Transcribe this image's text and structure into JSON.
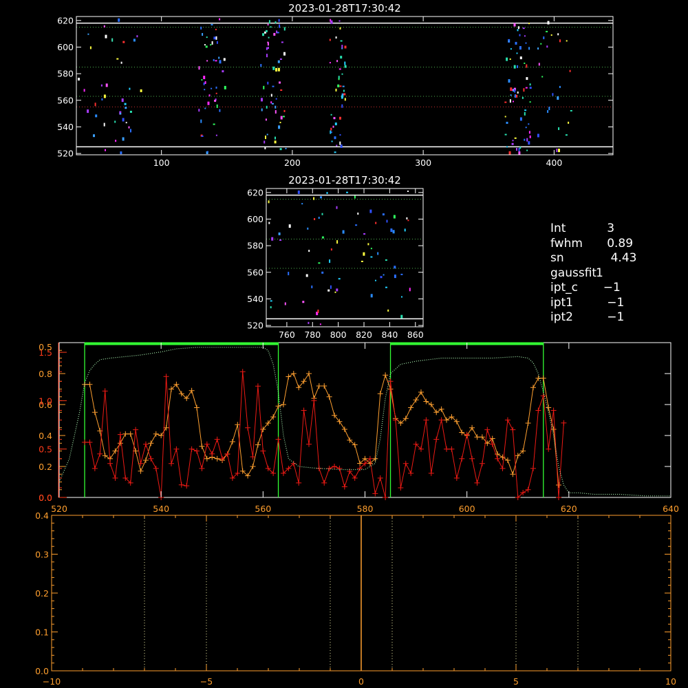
{
  "info_panel": {
    "rows": [
      {
        "key": "Int",
        "value": "   3"
      },
      {
        "key": "fwhm",
        "value": "   0.89"
      },
      {
        "key": "sn",
        "value": "    4.43"
      },
      {
        "key": "gaussfit",
        "value": "1"
      },
      {
        "key": "ipt_c",
        "value": "  −1"
      },
      {
        "key": "ipt1",
        "value": "   −1"
      },
      {
        "key": "ipt2",
        "value": "   −1"
      }
    ]
  },
  "colors": {
    "background": "#000000",
    "axes": "#ffffff",
    "axes_orange": "#ff9f2e",
    "axes_red": "#ff3a1a",
    "series_orange": "#ffa030",
    "series_red": "#ee1a14",
    "model_dotted": "#a8f0b0",
    "window_green": "#33ff33",
    "guide_green": "#4fb34f",
    "guide_red": "#d03030",
    "guide_yellow": "#e8e6a0"
  },
  "chart_data": [
    {
      "id": "top_image",
      "type": "heatmap",
      "title": "2023-01-28T17:30:42",
      "xlim": [
        35,
        445
      ],
      "ylim": [
        519,
        623
      ],
      "xticks": [
        100,
        200,
        300,
        400
      ],
      "yticks": [
        520,
        540,
        560,
        580,
        600,
        620
      ],
      "hlines_white": [
        618,
        525
      ],
      "hlines_green_dotted": [
        615,
        585,
        563
      ],
      "hlines_red_dotted": [
        555
      ],
      "pixel_columns": [
        {
          "x_center": 60,
          "spread": 25,
          "count": 40
        },
        {
          "x_center": 138,
          "spread": 10,
          "count": 45
        },
        {
          "x_center": 185,
          "spread": 10,
          "count": 55
        },
        {
          "x_center": 234,
          "spread": 6,
          "count": 45
        },
        {
          "x_center": 372,
          "spread": 10,
          "count": 65
        },
        {
          "x_center": 400,
          "spread": 15,
          "count": 25
        }
      ]
    },
    {
      "id": "zoom_image",
      "type": "heatmap",
      "title": "2023-01-28T17:30:42",
      "xlim": [
        744,
        866
      ],
      "ylim": [
        519,
        623
      ],
      "xticks": [
        760,
        780,
        800,
        820,
        840,
        860
      ],
      "yticks": [
        520,
        540,
        560,
        580,
        600,
        620
      ],
      "hlines_white": [
        618,
        525
      ],
      "hlines_green_dotted": [
        615,
        585,
        563
      ],
      "pixel_count": 75
    },
    {
      "id": "profile",
      "type": "line",
      "xlim": [
        520,
        640
      ],
      "xticks": [
        520,
        540,
        560,
        580,
        600,
        620,
        640
      ],
      "left_axis_orange": {
        "ylim": [
          0,
          1.0
        ],
        "ticks": [
          0.0,
          0.2,
          0.4,
          0.6,
          0.8
        ],
        "tick_labels": [
          "0.0",
          "0.2",
          "0.4",
          "0.6",
          "0.8"
        ]
      },
      "left_axis_red": {
        "ylim": [
          0,
          1.6
        ],
        "ticks": [
          0.0,
          0.5,
          1.0,
          1.5
        ],
        "tick_labels": [
          "0.0",
          "0.5",
          "1.0",
          "1.5"
        ]
      },
      "top_label": "0.5",
      "windows_green": [
        [
          525,
          563
        ],
        [
          585,
          615
        ]
      ],
      "window_level": 0.98,
      "series": [
        {
          "color": "orange",
          "marker": "+",
          "x": [
            525,
            526,
            527,
            528,
            529,
            530,
            531,
            532,
            533,
            534,
            535,
            536,
            537,
            538,
            539,
            540,
            541,
            542,
            543,
            544,
            545,
            546,
            547,
            548,
            549,
            550,
            551,
            552,
            553,
            554,
            555,
            556,
            557,
            558,
            559,
            560,
            561,
            562,
            563,
            564,
            565,
            566,
            567,
            568,
            569,
            570,
            571,
            572,
            573,
            574,
            575,
            576,
            577,
            578,
            579,
            580,
            581,
            582,
            583,
            584,
            585,
            586,
            587,
            588,
            589,
            590,
            591,
            592,
            593,
            594,
            595,
            596,
            597,
            598,
            599,
            600,
            601,
            602,
            603,
            604,
            605,
            606,
            607,
            608,
            609,
            610,
            611,
            612,
            613,
            614,
            615,
            616,
            617,
            618
          ],
          "y": [
            0.73,
            0.73,
            0.55,
            0.43,
            0.27,
            0.25,
            0.3,
            0.35,
            0.41,
            0.41,
            0.3,
            0.17,
            0.24,
            0.35,
            0.41,
            0.4,
            0.45,
            0.7,
            0.73,
            0.67,
            0.64,
            0.69,
            0.58,
            0.33,
            0.25,
            0.26,
            0.25,
            0.24,
            0.28,
            0.36,
            0.47,
            0.17,
            0.14,
            0.2,
            0.34,
            0.44,
            0.48,
            0.52,
            0.59,
            0.6,
            0.78,
            0.8,
            0.71,
            0.75,
            0.8,
            0.64,
            0.72,
            0.72,
            0.65,
            0.53,
            0.49,
            0.44,
            0.37,
            0.34,
            0.22,
            0.25,
            0.22,
            0.25,
            0.67,
            0.79,
            0.7,
            0.51,
            0.48,
            0.51,
            0.58,
            0.63,
            0.68,
            0.62,
            0.6,
            0.55,
            0.57,
            0.5,
            0.52,
            0.49,
            0.42,
            0.4,
            0.45,
            0.39,
            0.39,
            0.35,
            0.38,
            0.28,
            0.26,
            0.24,
            0.15,
            0.27,
            0.3,
            0.48,
            0.71,
            0.77,
            0.77,
            0.58,
            0.44,
            0.08
          ]
        },
        {
          "color": "red",
          "marker": "+",
          "x": [
            525,
            526,
            527,
            528,
            529,
            530,
            531,
            532,
            533,
            534,
            535,
            536,
            537,
            538,
            539,
            540,
            541,
            542,
            543,
            544,
            545,
            546,
            547,
            548,
            549,
            550,
            551,
            552,
            553,
            554,
            555,
            556,
            557,
            558,
            559,
            560,
            561,
            562,
            563,
            564,
            565,
            566,
            567,
            568,
            569,
            570,
            571,
            572,
            573,
            574,
            575,
            576,
            577,
            578,
            579,
            580,
            581,
            582,
            583,
            584,
            585,
            586,
            587,
            588,
            589,
            590,
            591,
            592,
            593,
            594,
            595,
            596,
            597,
            598,
            599,
            600,
            601,
            602,
            603,
            604,
            605,
            606,
            607,
            608,
            609,
            610,
            611,
            612,
            613,
            614,
            615,
            616,
            617,
            618,
            619
          ],
          "y": [
            0.57,
            0.57,
            0.3,
            0.45,
            1.1,
            0.35,
            0.2,
            0.65,
            0.2,
            0.15,
            0.7,
            0.35,
            0.55,
            0.4,
            0.3,
            0.0,
            1.25,
            0.35,
            0.5,
            0.13,
            0.12,
            0.5,
            0.48,
            0.3,
            0.55,
            0.45,
            0.6,
            0.4,
            0.45,
            0.2,
            0.25,
            1.3,
            0.72,
            0.42,
            1.15,
            0.48,
            0.3,
            0.25,
            0.6,
            0.25,
            0.3,
            0.35,
            0.15,
            0.9,
            0.55,
            1.0,
            0.3,
            0.15,
            0.3,
            0.32,
            0.3,
            0.11,
            0.27,
            0.2,
            0.3,
            0.35,
            0.4,
            0.04,
            0.2,
            0.0,
            1.2,
            0.8,
            0.1,
            0.35,
            0.25,
            0.55,
            0.5,
            0.8,
            0.25,
            0.6,
            0.8,
            0.5,
            0.5,
            0.2,
            0.4,
            0.65,
            0.4,
            0.15,
            0.35,
            0.7,
            0.55,
            0.4,
            0.3,
            0.8,
            0.7,
            0.0,
            0.05,
            0.08,
            0.3,
            0.9,
            1.05,
            0.5,
            0.9,
            0.0,
            0.77
          ]
        },
        {
          "color": "model",
          "style": "dotted",
          "x": [
            520,
            522,
            524,
            525,
            526,
            527,
            528,
            530,
            533,
            536,
            540,
            543,
            547,
            550,
            555,
            558,
            560,
            561,
            562,
            563,
            564,
            565,
            567,
            570,
            575,
            580,
            582,
            583,
            584,
            585,
            587,
            590,
            595,
            600,
            605,
            610,
            612,
            613,
            614,
            615,
            616,
            617,
            618,
            619,
            620,
            622,
            625,
            630,
            635,
            640
          ],
          "y": [
            0.1,
            0.25,
            0.55,
            0.74,
            0.82,
            0.86,
            0.89,
            0.9,
            0.91,
            0.92,
            0.94,
            0.96,
            0.97,
            0.97,
            0.97,
            0.97,
            0.97,
            0.95,
            0.86,
            0.68,
            0.4,
            0.25,
            0.2,
            0.19,
            0.18,
            0.18,
            0.22,
            0.38,
            0.64,
            0.8,
            0.86,
            0.88,
            0.9,
            0.9,
            0.9,
            0.91,
            0.9,
            0.87,
            0.8,
            0.68,
            0.55,
            0.4,
            0.2,
            0.08,
            0.03,
            0.03,
            0.02,
            0.02,
            0.01,
            0.01
          ]
        }
      ]
    },
    {
      "id": "lag",
      "type": "line",
      "xlim": [
        -10,
        10
      ],
      "xticks": [
        -10,
        -5,
        0,
        5,
        10
      ],
      "xtick_labels": [
        "−10",
        "−5",
        "0",
        "5",
        "10"
      ],
      "ylim": [
        0,
        0.4
      ],
      "yticks": [
        0.0,
        0.1,
        0.2,
        0.3,
        0.4
      ],
      "ytick_labels": [
        "0.0",
        "0.1",
        "0.2",
        "0.3",
        "0.4"
      ],
      "vlines_dotted": [
        -7,
        -5,
        -1,
        1,
        5,
        7
      ],
      "vline_solid": 0
    }
  ]
}
